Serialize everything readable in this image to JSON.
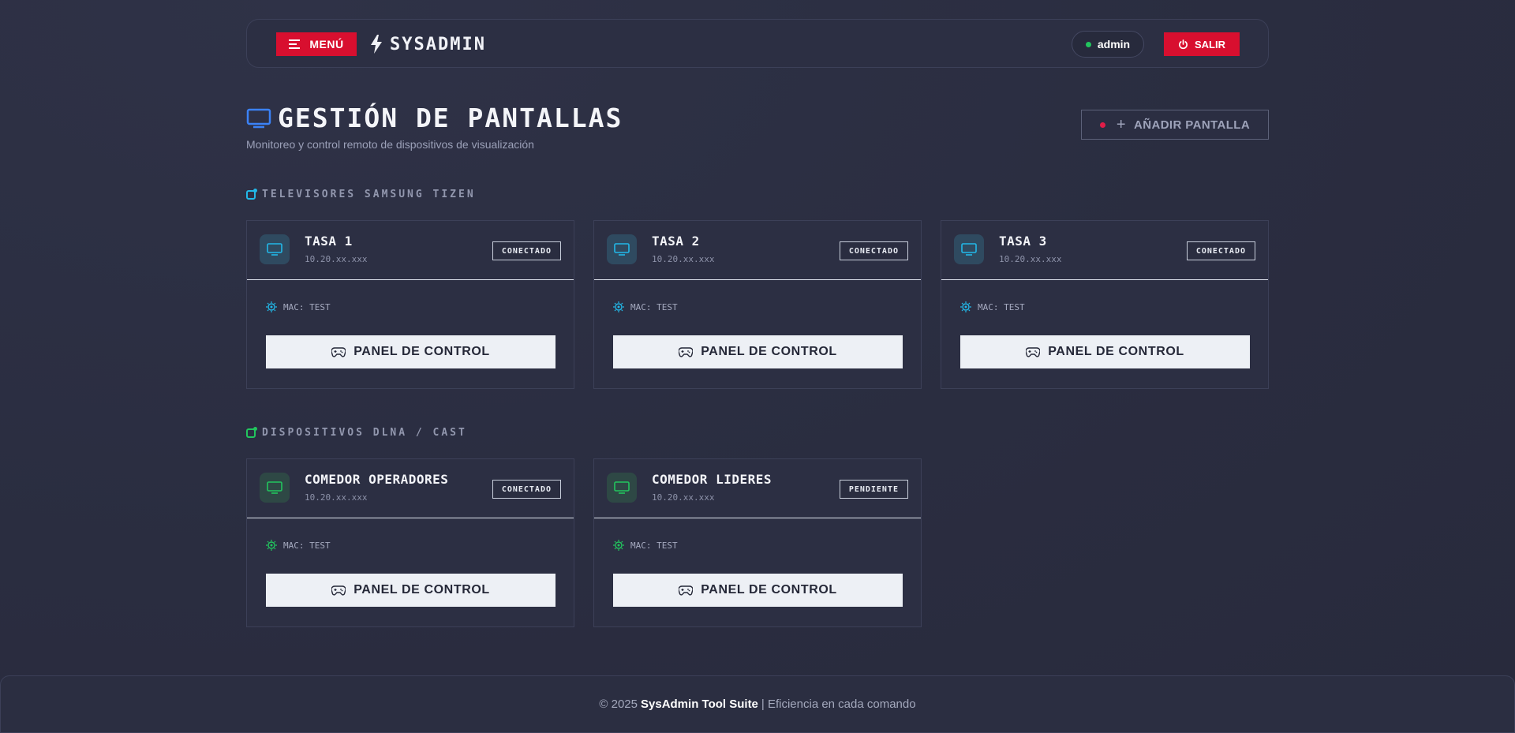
{
  "navbar": {
    "menu_label": "MENÚ",
    "brand": "SYSADMIN",
    "user": "admin",
    "logout_label": "SALIR"
  },
  "header": {
    "title": "GESTIÓN DE PANTALLAS",
    "subtitle": "Monitoreo y control remoto de dispositivos de visualización",
    "add_button": "AÑADIR PANTALLA"
  },
  "sections": [
    {
      "title": "TELEVISORES SAMSUNG TIZEN",
      "accent": "#22b8e8",
      "devices": [
        {
          "name": "TASA 1",
          "ip": "10.20.xx.xxx",
          "status": "CONECTADO",
          "mac": "MAC: TEST",
          "button": "PANEL DE CONTROL"
        },
        {
          "name": "TASA 2",
          "ip": "10.20.xx.xxx",
          "status": "CONECTADO",
          "mac": "MAC: TEST",
          "button": "PANEL DE CONTROL"
        },
        {
          "name": "TASA 3",
          "ip": "10.20.xx.xxx",
          "status": "CONECTADO",
          "mac": "MAC: TEST",
          "button": "PANEL DE CONTROL"
        }
      ]
    },
    {
      "title": "DISPOSITIVOS DLNA / CAST",
      "accent": "#22c55e",
      "devices": [
        {
          "name": "COMEDOR OPERADORES",
          "ip": "10.20.xx.xxx",
          "status": "CONECTADO",
          "mac": "MAC: TEST",
          "button": "PANEL DE CONTROL"
        },
        {
          "name": "COMEDOR LIDERES",
          "ip": "10.20.xx.xxx",
          "status": "PENDIENTE",
          "mac": "MAC: TEST",
          "button": "PANEL DE CONTROL"
        }
      ]
    }
  ],
  "footer": {
    "prefix": "© 2025",
    "brand": "SysAdmin Tool Suite",
    "suffix": "| Eficiencia en cada comando"
  },
  "colors": {
    "primary_red": "#d80f2f",
    "background": "#2a2d40",
    "title_blue": "#3b82f6"
  }
}
